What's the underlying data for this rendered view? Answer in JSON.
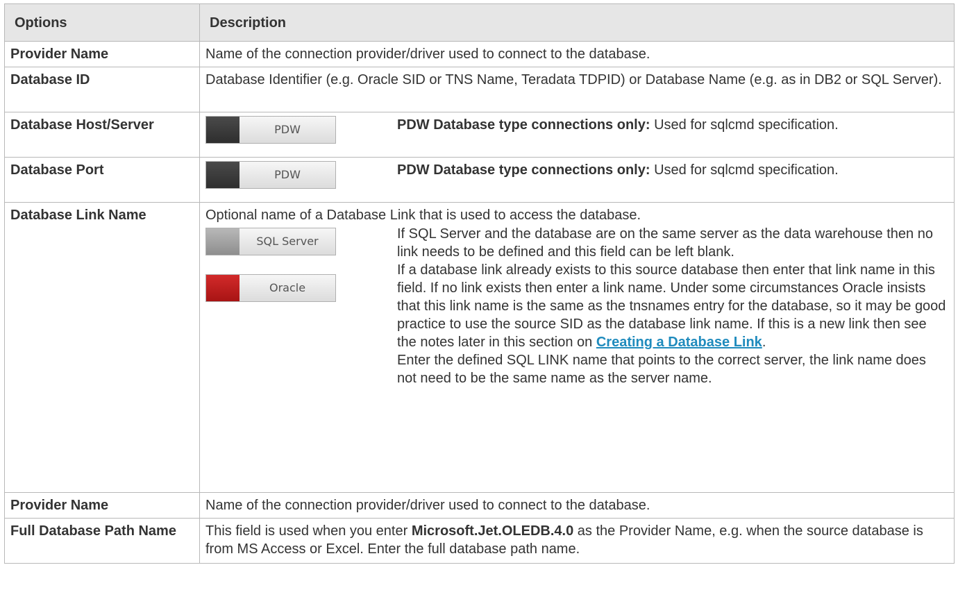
{
  "header": {
    "options": "Options",
    "description": "Description"
  },
  "rows": [
    {
      "option": "Provider Name",
      "description": "Name of the connection provider/driver used to connect to the database."
    },
    {
      "option": "Database ID",
      "description": "Database Identifier (e.g. Oracle SID or TNS Name, Teradata TDPID) or Database Name (e.g. as in DB2 or SQL Server)."
    },
    {
      "option": "Database Host/Server",
      "badge": "PDW",
      "note_bold": "PDW Database type connections only:",
      "note": " Used for sqlcmd specification."
    },
    {
      "option": "Database Port",
      "badge": "PDW",
      "note_bold": "PDW Database type connections only:",
      "note": " Used for sqlcmd specification."
    },
    {
      "option": "Database Link Name",
      "intro": "Optional name of a Database Link that is used to access the database.",
      "badge_sql": "SQL Server",
      "badge_oracle": "Oracle",
      "sql_text": "If SQL Server and the database are on the same server as the data warehouse then no link needs to be defined and this field can be left blank.",
      "oracle_text": "If a database link already exists to this source database then enter that link name in this field. If no link exists then enter a link name. Under some circumstances Oracle insists that this link name is the same as the tnsnames entry for the database, so it may be good practice to use the source SID as the database link name. If this is a new link then see the notes later in this section on ",
      "oracle_link": "Creating a Database Link",
      "oracle_tail": ".",
      "sql_link_text": "Enter the defined SQL LINK name that points to the correct server, the link name does not need to be the same name as the server name."
    },
    {
      "option": "Provider Name",
      "description": "Name of the connection provider/driver used to connect to the database."
    },
    {
      "option": "Full Database Path Name",
      "desc_pre": "This field is used when you enter ",
      "desc_bold": "Microsoft.Jet.OLEDB.4.0",
      "desc_post": " as the Provider Name, e.g. when the source database is from MS Access or Excel. Enter the full database path name."
    }
  ],
  "colors": {
    "header_bg": "#e6e6e6",
    "link": "#1f8bbd",
    "pdw_swatch": "#3a3a3a",
    "sql_swatch": "#a3a3a3",
    "oracle_swatch": "#c01f1f"
  }
}
